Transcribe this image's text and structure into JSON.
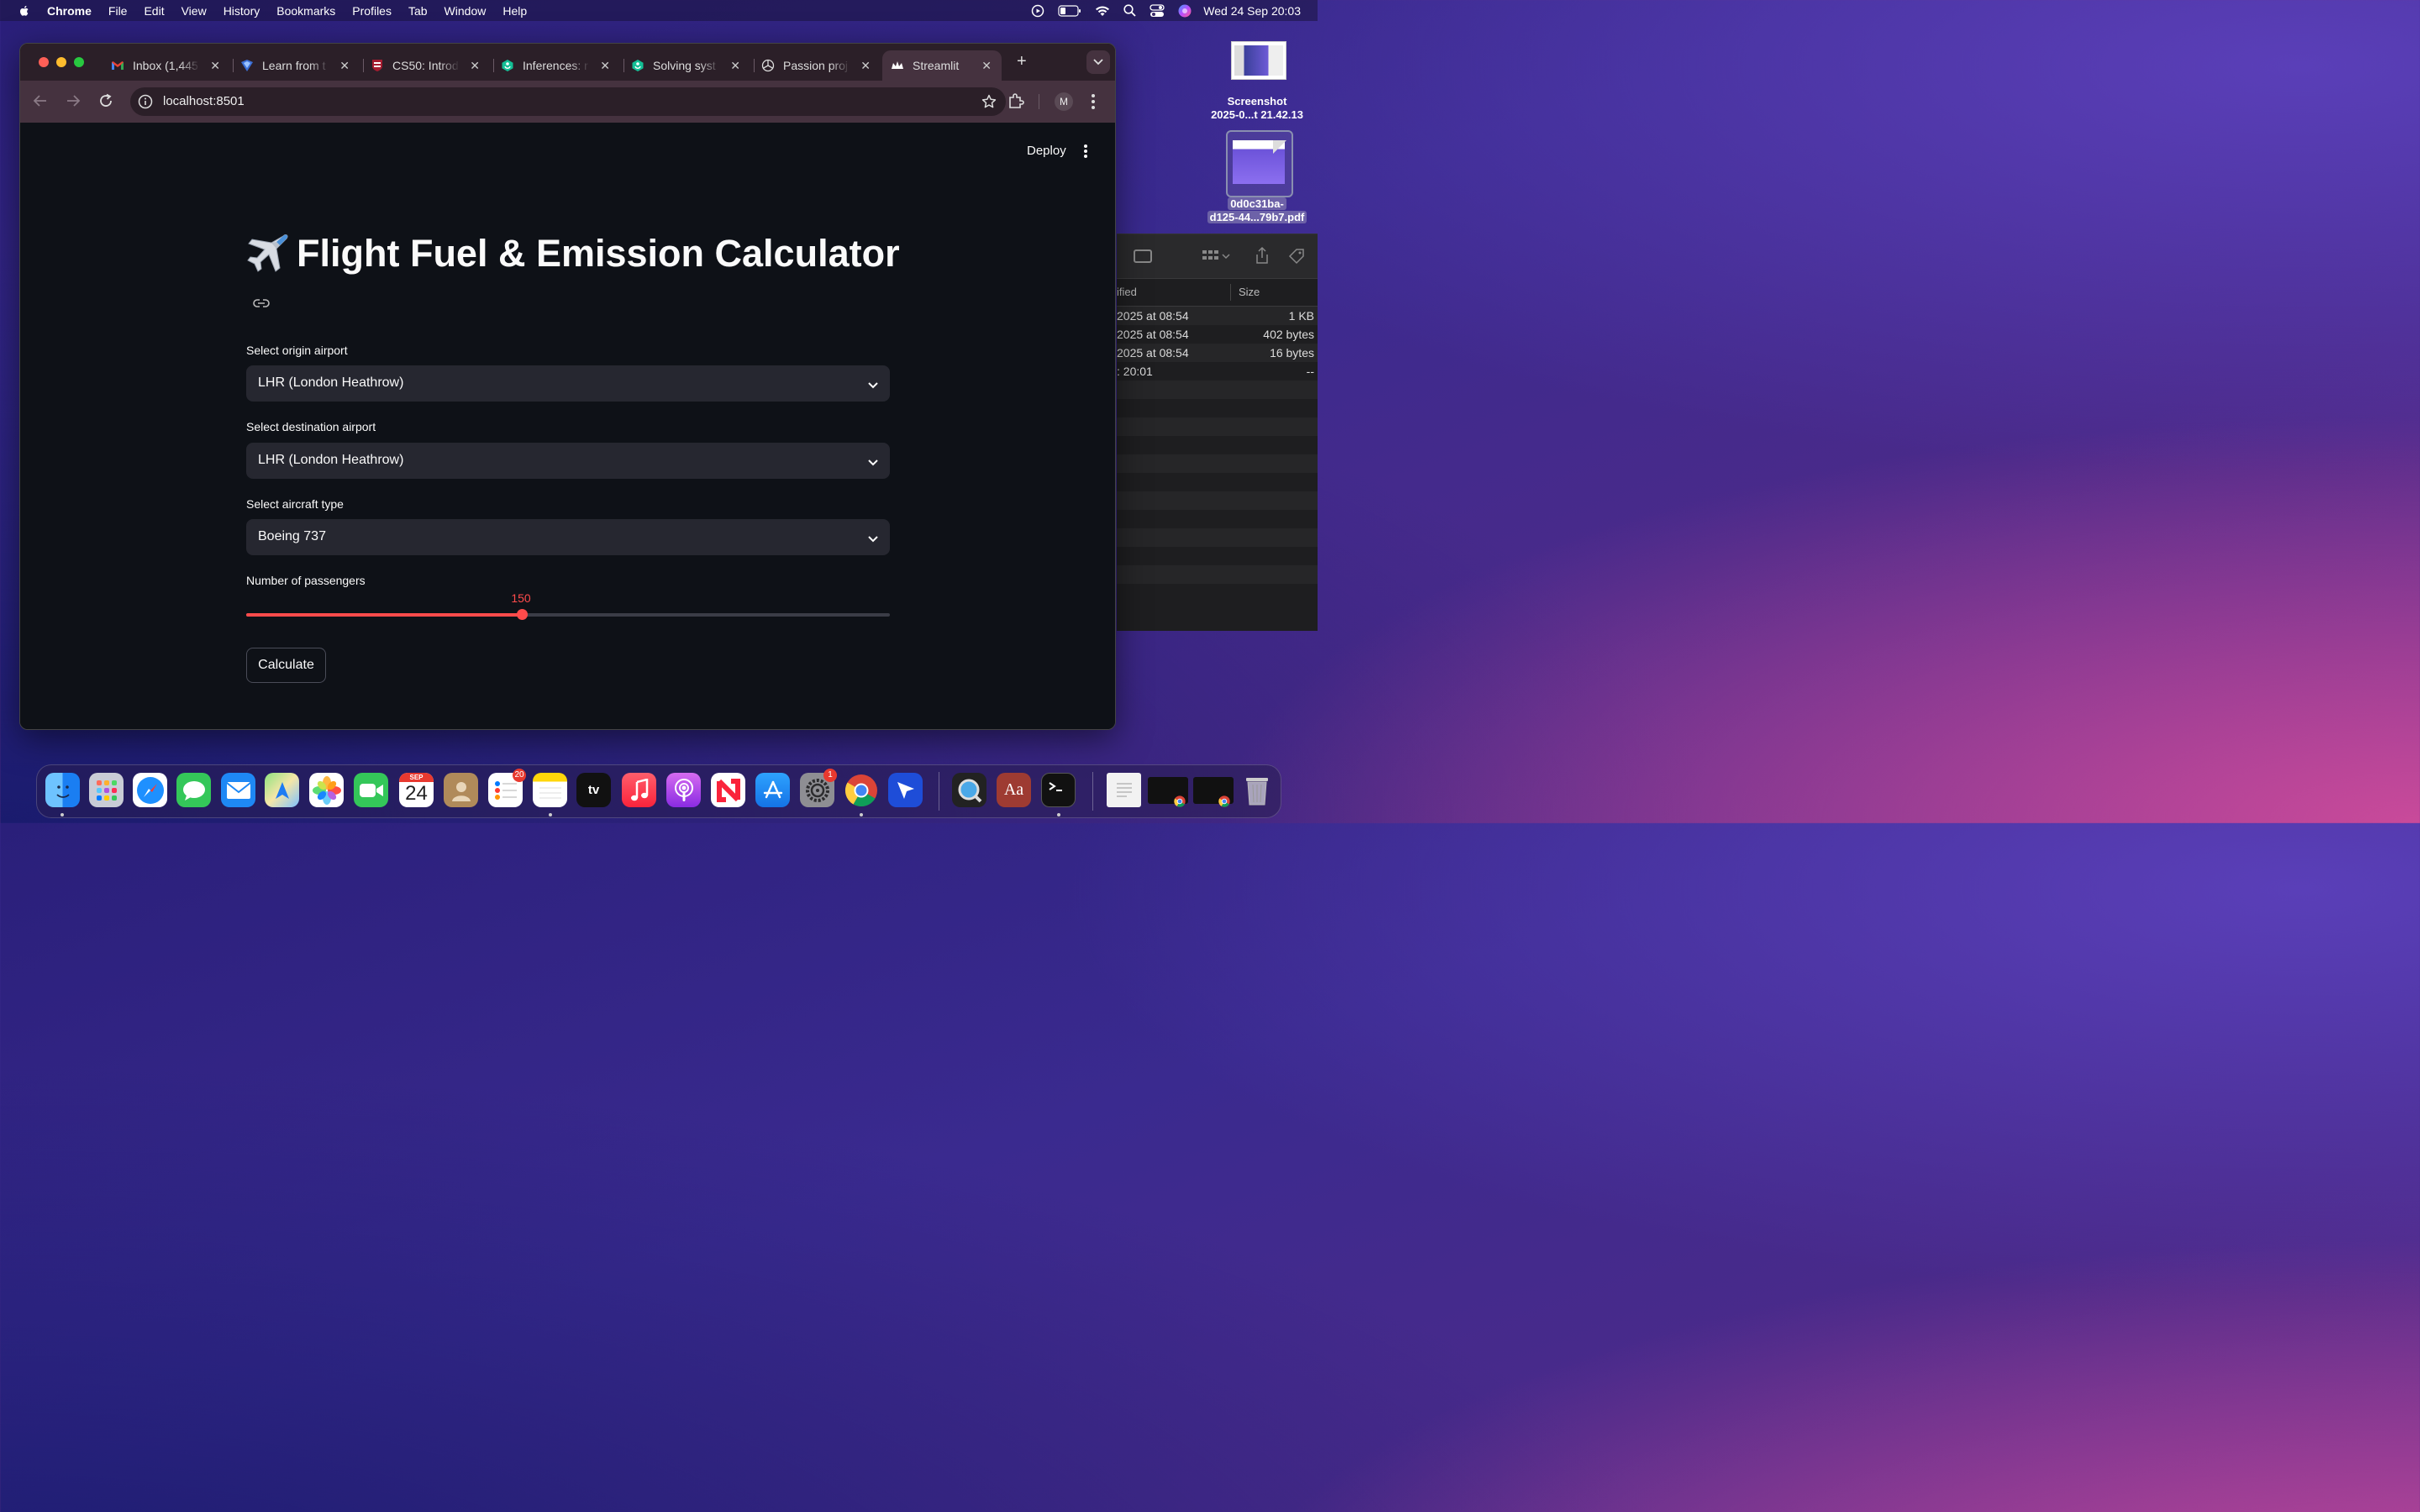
{
  "menubar": {
    "app": "Chrome",
    "items": [
      "File",
      "Edit",
      "View",
      "History",
      "Bookmarks",
      "Profiles",
      "Tab",
      "Window",
      "Help"
    ],
    "clock": "Wed 24 Sep  20:03"
  },
  "desktop": {
    "screenshot_label_line1": "Screenshot",
    "screenshot_label_line2": "2025-0...t 21.42.13",
    "pdf_label_line1": "0d0c31ba-",
    "pdf_label_line2": "d125-44...79b7.pdf"
  },
  "finder": {
    "col_modified": "ified",
    "col_size": "Size",
    "rows": [
      {
        "date": "2025 at 08:54",
        "size": "1 KB"
      },
      {
        "date": "2025 at 08:54",
        "size": "402 bytes"
      },
      {
        "date": "2025 at 08:54",
        "size": "16 bytes"
      },
      {
        "date": ": 20:01",
        "size": "--"
      }
    ]
  },
  "browser": {
    "tabs": [
      {
        "title": "Inbox (1,445",
        "icon": "gmail-icon"
      },
      {
        "title": "Learn from t",
        "icon": "learn-icon"
      },
      {
        "title": "CS50: Introd",
        "icon": "harvard-icon"
      },
      {
        "title": "Inferences: r",
        "icon": "khan-icon"
      },
      {
        "title": "Solving syst",
        "icon": "khan-icon"
      },
      {
        "title": "Passion proj",
        "icon": "openai-icon"
      },
      {
        "title": "Streamlit",
        "icon": "streamlit-icon"
      }
    ],
    "url": "localhost:8501",
    "profile_initial": "M"
  },
  "app": {
    "deploy_label": "Deploy",
    "title": "Flight Fuel & Emission Calculator",
    "origin_label": "Select origin airport",
    "origin_value": "LHR (London Heathrow)",
    "destination_label": "Select destination airport",
    "destination_value": "LHR (London Heathrow)",
    "aircraft_label": "Select aircraft type",
    "aircraft_value": "Boeing 737",
    "passengers_label": "Number of passengers",
    "passengers_value": "150",
    "passengers_fraction": 0.428,
    "calculate_label": "Calculate",
    "accent_color": "#ff4b4b"
  },
  "dock": {
    "calendar_month": "SEP",
    "calendar_day": "24",
    "reminders_badge": "20",
    "settings_badge": "1",
    "tv_label": "tv",
    "dictionary_label": "Aa"
  }
}
